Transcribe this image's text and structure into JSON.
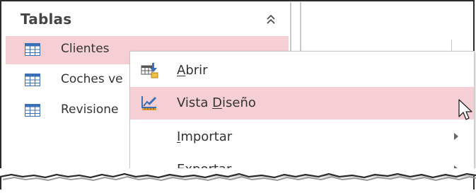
{
  "nav": {
    "title": "Tablas",
    "items": [
      {
        "label": "Clientes",
        "icon": "table-icon",
        "selected": true
      },
      {
        "label": "Coches ve",
        "icon": "table-icon"
      },
      {
        "label": "Revisione",
        "icon": "table-icon"
      }
    ]
  },
  "context_menu": {
    "items": [
      {
        "pre": "",
        "key": "A",
        "post": "brir",
        "icon": "open-table-icon",
        "submenu": false
      },
      {
        "pre": "Vista ",
        "key": "D",
        "post": "iseño",
        "icon": "design-view-icon",
        "submenu": false,
        "hover": true
      },
      {
        "pre": "",
        "key": "I",
        "post": "mportar",
        "icon": "",
        "submenu": true
      },
      {
        "pre": "",
        "key": "E",
        "post": "xportar",
        "icon": "",
        "submenu": true
      }
    ]
  },
  "colors": {
    "selection": "#f6cfd4",
    "text": "#333333",
    "table_icon": "#3b6fb6"
  }
}
